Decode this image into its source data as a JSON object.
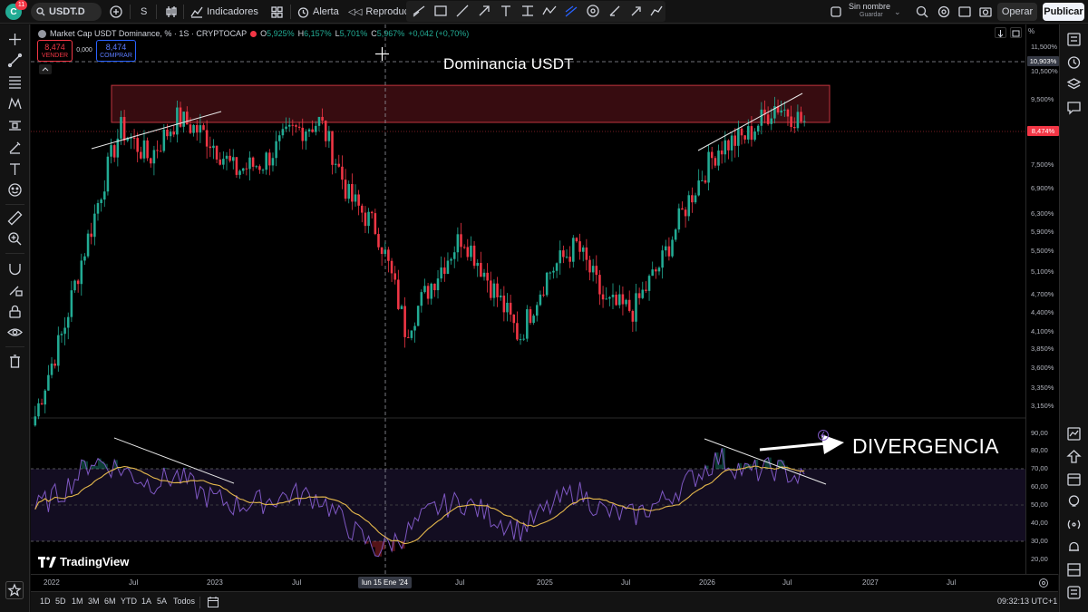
{
  "topbar": {
    "avatar_letter": "C",
    "avatar_badge": "11",
    "symbol": "USDT.D",
    "interval": "S",
    "indicators_label": "Indicadores",
    "alert_label": "Alerta",
    "replay_label": "Reproduc",
    "layout_name": "Sin nombre",
    "layout_status": "Guardar",
    "trade_label": "Operar",
    "publish_label": "Publicar"
  },
  "legend": {
    "title": "Market Cap USDT Dominance, % · 1S · CRYPTOCAP",
    "open_label": "O",
    "open_value": "5,925%",
    "high_label": "H",
    "high_value": "6,157%",
    "low_label": "L",
    "low_value": "5,701%",
    "close_label": "C",
    "close_value": "5,967%",
    "change": "+0,042 (+0,70%)"
  },
  "trade": {
    "sell_price": "8,474",
    "sell_label": "VENDER",
    "spread": "0,000",
    "buy_price": "8,474",
    "buy_label": "COMPRAR"
  },
  "annotations": {
    "title": "Dominancia USDT",
    "divergence": "DIVERGENCIA"
  },
  "price_axis": {
    "unit": "%",
    "labels": [
      "11,500%",
      "10,500%",
      "9,500%",
      "7,500%",
      "6,900%",
      "6,300%",
      "5,900%",
      "5,500%",
      "5,100%",
      "4,700%",
      "4,400%",
      "4,100%",
      "3,850%",
      "3,600%",
      "3,350%",
      "3,150%"
    ],
    "crosshair_value": "10,903%",
    "last_price": "8,474%"
  },
  "rsi_axis": {
    "labels": [
      "90,00",
      "80,00",
      "70,00",
      "60,00",
      "50,00",
      "40,00",
      "30,00",
      "20,00"
    ]
  },
  "time_axis": {
    "labels": [
      "2022",
      "Jul",
      "2023",
      "Jul",
      "Jul",
      "2025",
      "Jul",
      "2026",
      "Jul",
      "2027",
      "Jul"
    ],
    "crosshair_label": "lun 15 Ene '24"
  },
  "bottombar": {
    "ranges": [
      "1D",
      "5D",
      "1M",
      "3M",
      "6M",
      "YTD",
      "1A",
      "5A",
      "Todos"
    ],
    "clock": "09:32:13 UTC+1"
  },
  "branding": {
    "logo_text": "TradingView"
  },
  "colors": {
    "up": "#22ab94",
    "down": "#f23645",
    "rsi_line": "#7e57c2",
    "rsi_ma": "#e5b84c",
    "resistance_zone": "#4a1015",
    "crosshair_badge": "#363a45"
  },
  "chart_data": {
    "type": "candlestick",
    "title": "Market Cap USDT Dominance, % · 1S · CRYPTOCAP",
    "xlabel": "",
    "ylabel": "",
    "log_scale": true,
    "ylim": [
      3.15,
      11.5
    ],
    "resistance_zone": [
      8.474,
      9.6
    ],
    "x": [
      "2022-01",
      "2022-03",
      "2022-05",
      "2022-07",
      "2022-09",
      "2022-11",
      "2023-01",
      "2023-03",
      "2023-05",
      "2023-07",
      "2023-09",
      "2023-11",
      "2024-01",
      "2024-03",
      "2024-05",
      "2024-07",
      "2024-09",
      "2024-11",
      "2025-01",
      "2025-03",
      "2025-05",
      "2025-07",
      "2025-09",
      "2025-11",
      "2026-01",
      "2026-03",
      "2026-05",
      "2026-06"
    ],
    "close": [
      3.15,
      4.2,
      6.0,
      8.3,
      7.5,
      8.6,
      8.1,
      7.2,
      7.4,
      8.2,
      8.5,
      6.6,
      5.9,
      4.2,
      5.0,
      5.8,
      4.9,
      4.1,
      5.1,
      5.6,
      4.6,
      4.5,
      5.3,
      6.6,
      7.8,
      8.1,
      9.0,
      8.47
    ],
    "rsi": {
      "name": "RSI",
      "levels": [
        30,
        50,
        70
      ],
      "values": [
        48,
        58,
        75,
        70,
        62,
        66,
        55,
        50,
        52,
        56,
        54,
        38,
        25,
        34,
        48,
        52,
        44,
        36,
        48,
        58,
        46,
        44,
        52,
        64,
        76,
        68,
        70,
        64
      ]
    }
  }
}
